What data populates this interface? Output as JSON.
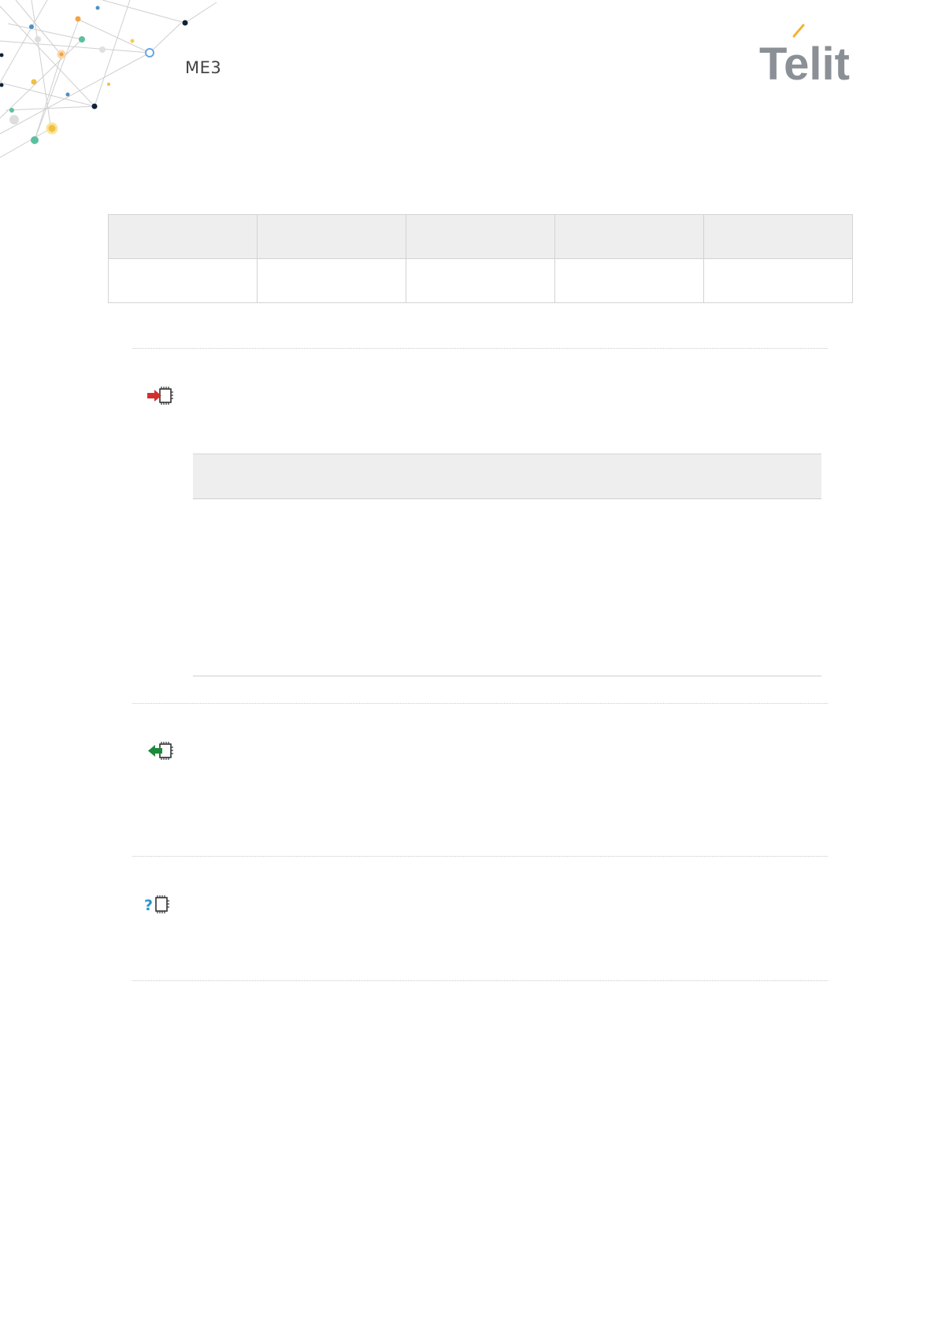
{
  "header": {
    "title": "ME3",
    "logo_text": "Telit"
  },
  "colors": {
    "table_header_bg": "#eeeeee",
    "border": "#d3d3d3",
    "set_icon_arrow": "#d32f2f",
    "read_icon_arrow": "#1b8a3a",
    "test_icon_question": "#2b95c8"
  },
  "info_table": {
    "columns": 5,
    "header_row": [
      "",
      "",
      "",
      "",
      ""
    ],
    "data_row": [
      "",
      "",
      "",
      "",
      ""
    ]
  },
  "sections": [
    {
      "icon": "set-command-icon"
    },
    {
      "icon": "read-command-icon"
    },
    {
      "icon": "test-command-icon"
    }
  ],
  "parameter_table": {
    "header": "",
    "rows": []
  }
}
